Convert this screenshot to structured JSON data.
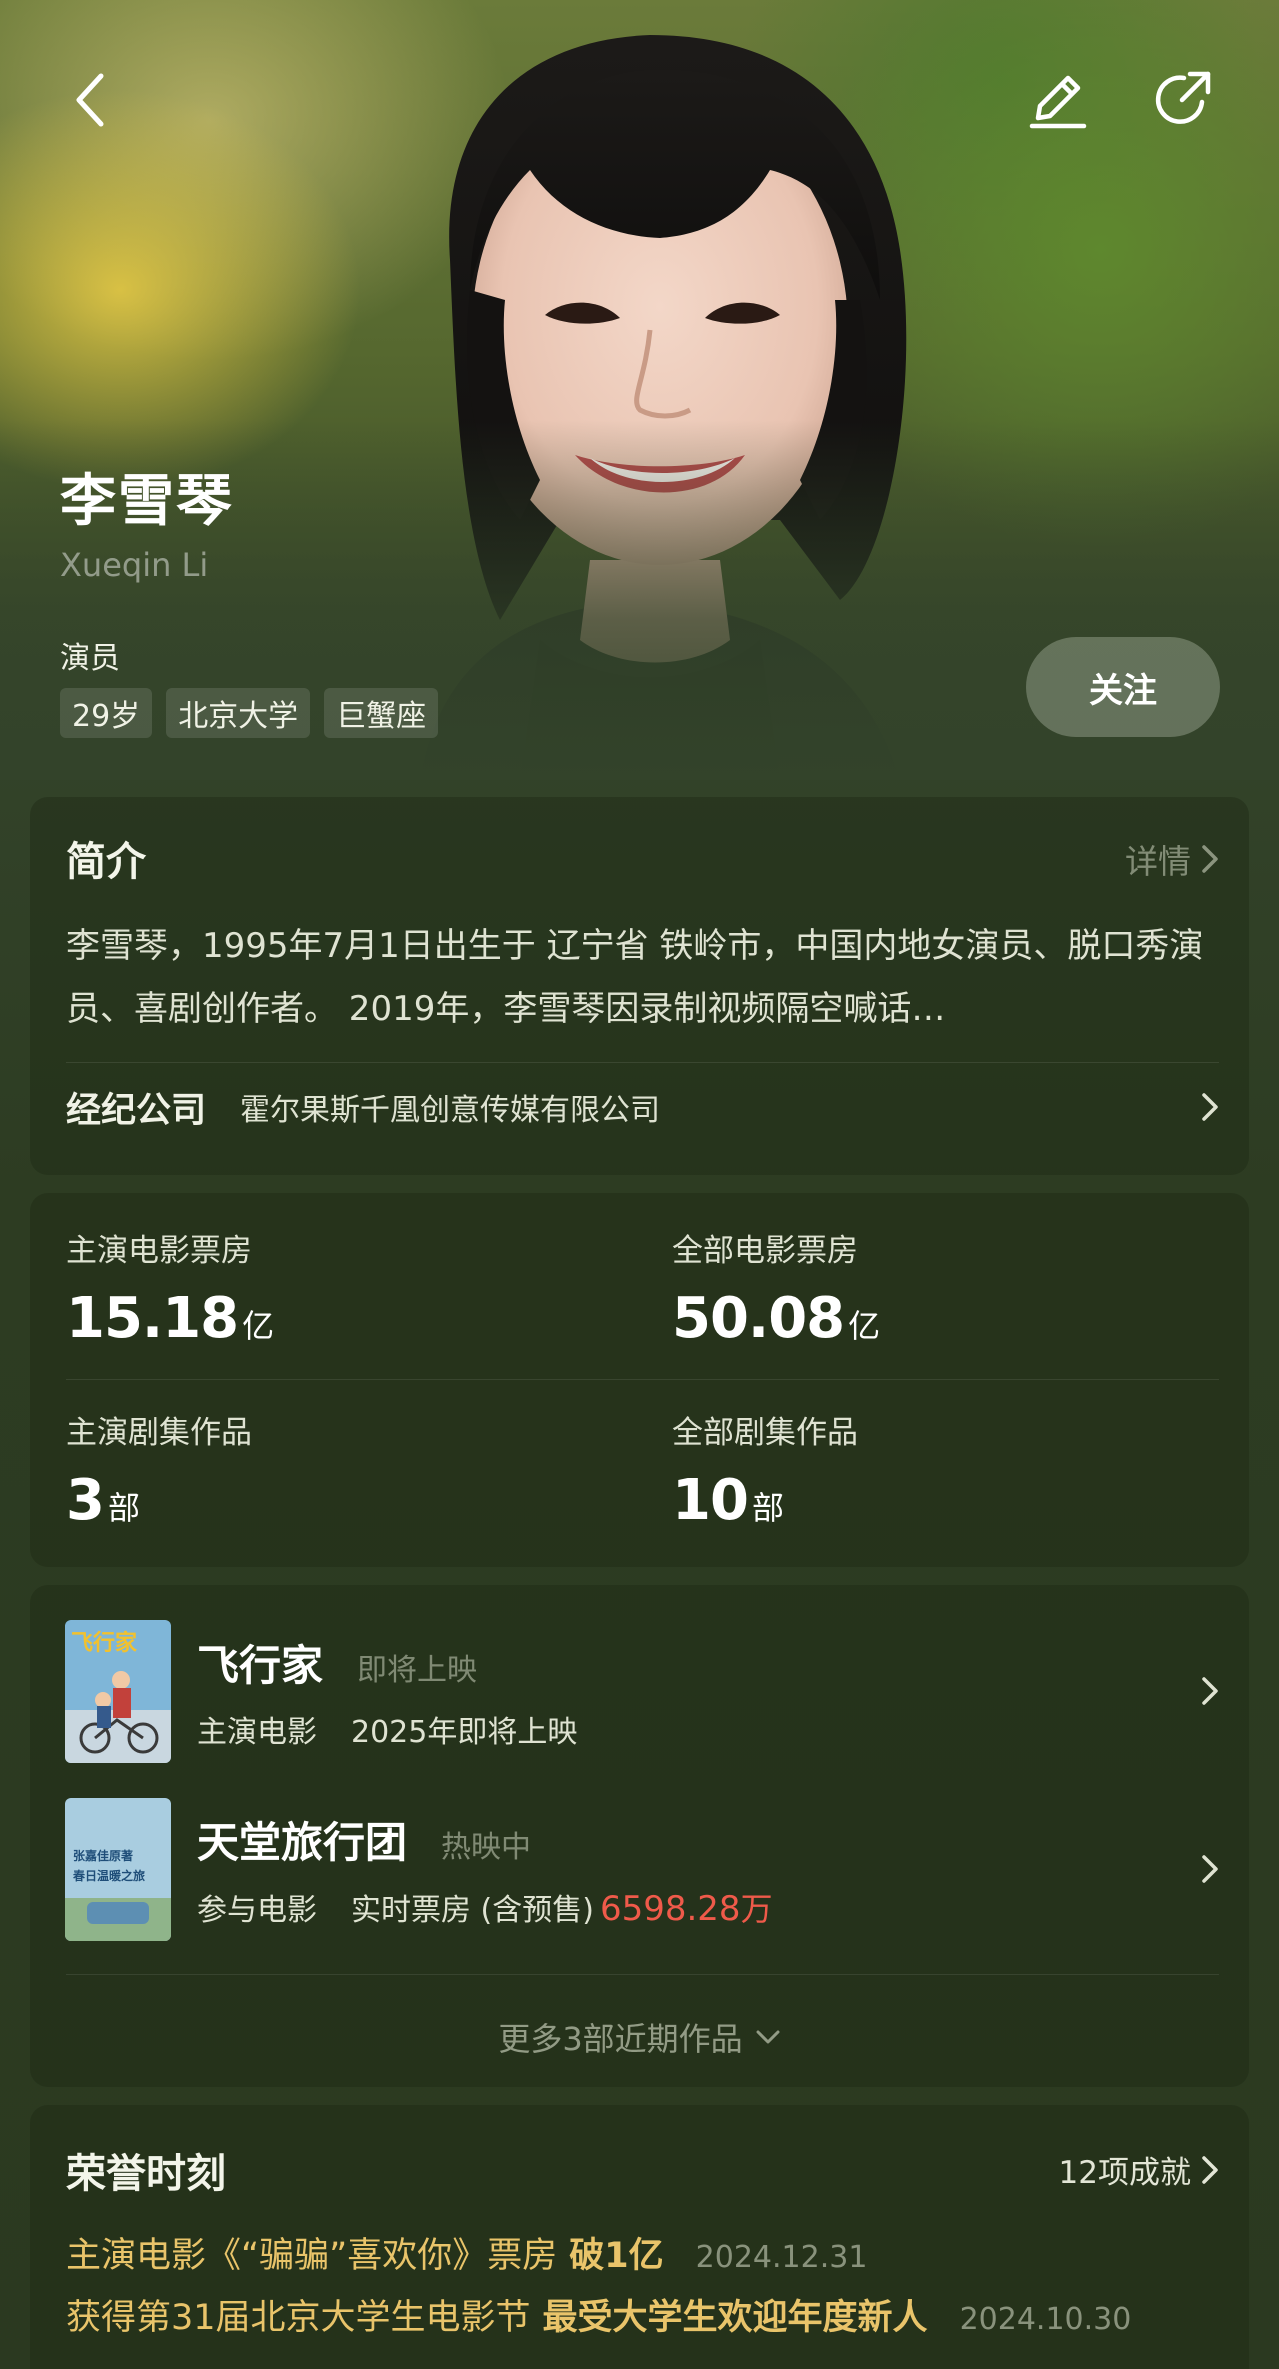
{
  "colors": {
    "background": "#2c3a1f",
    "accent_red": "#ef5a4a",
    "honor_gold": "#e9c46a"
  },
  "header": {
    "back_icon": "back-icon",
    "edit_icon": "edit-icon",
    "share_icon": "share-icon"
  },
  "profile": {
    "name": "李雪琴",
    "name_en": "Xueqin Li",
    "role": "演员",
    "tags": [
      "29岁",
      "北京大学",
      "巨蟹座"
    ],
    "follow_label": "关注"
  },
  "intro": {
    "title": "简介",
    "detail_label": "详情",
    "text": "李雪琴，1995年7月1日出生于 辽宁省 铁岭市，中国内地女演员、脱口秀演员、喜剧创作者。 2019年，李雪琴因录制视频隔空喊话…",
    "agency_label": "经纪公司",
    "agency_value": "霍尔果斯千凰创意传媒有限公司"
  },
  "stats": [
    {
      "label": "主演电影票房",
      "value": "15.18",
      "unit": "亿"
    },
    {
      "label": "全部电影票房",
      "value": "50.08",
      "unit": "亿"
    },
    {
      "label": "主演剧集作品",
      "value": "3",
      "unit": "部"
    },
    {
      "label": "全部剧集作品",
      "value": "10",
      "unit": "部"
    }
  ],
  "works": {
    "items": [
      {
        "title": "飞行家",
        "status": "即将上映",
        "type": "主演电影",
        "info": "2025年即将上映",
        "poster_title": "飞行家"
      },
      {
        "title": "天堂旅行团",
        "status": "热映中",
        "type": "参与电影",
        "info": "实时票房 (含预售)",
        "box_value": "6598.28",
        "box_unit": "万",
        "poster_lines": [
          "张嘉佳原著",
          "春日温暖之旅"
        ]
      }
    ],
    "more_label": "更多3部近期作品"
  },
  "honors": {
    "title": "荣誉时刻",
    "count_label": "12项成就",
    "items": [
      {
        "text": "主演电影《“骗骗”喜欢你》票房",
        "highlight": "破1亿",
        "date": "2024.12.31"
      },
      {
        "text": "获得第31届北京大学生电影节",
        "highlight": "最受大学生欢迎年度新人",
        "date": "2024.10.30"
      }
    ]
  }
}
